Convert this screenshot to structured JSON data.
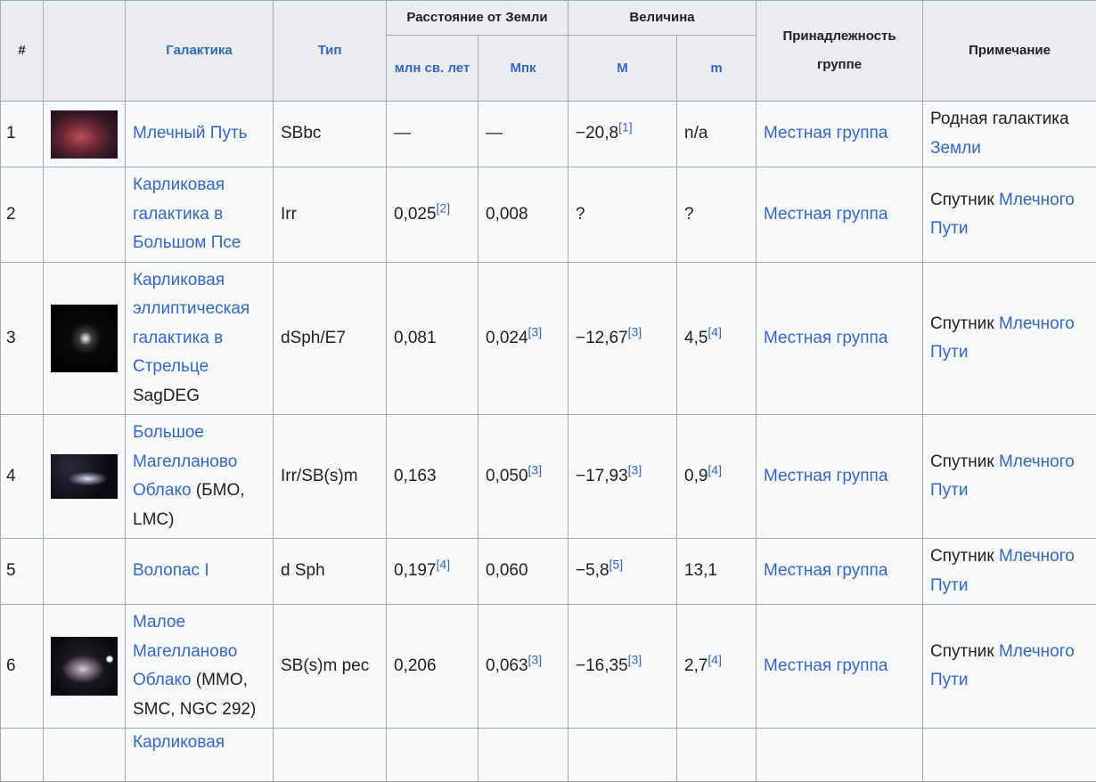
{
  "table": {
    "headers": {
      "num": "#",
      "galaxy": "Галактика",
      "type": "Тип",
      "distance": "Расстояние от Земли",
      "magnitude": "Величина",
      "group": "Принадлежность группе",
      "note": "Примечание",
      "mly": "млн св. лет",
      "mpc": "Мпк",
      "abs_m": "M",
      "app_m": "m"
    },
    "rows": [
      {
        "num": "1",
        "image": "milky-way-thumbnail",
        "name": "Млечный Путь",
        "name_extra": "",
        "type": "SBbc",
        "mly": "—",
        "mly_ref": "",
        "mpc": "—",
        "mpc_ref": "",
        "abs_m": "−20,8",
        "abs_m_ref": "[1]",
        "app_m": "n/a",
        "app_m_ref": "",
        "group": "Местная группа",
        "note_text": "Родная галактика ",
        "note_link": "Земли"
      },
      {
        "num": "2",
        "image": "",
        "name": "Карликовая галактика в Большом Псе",
        "name_extra": "",
        "type": "Irr",
        "mly": "0,025",
        "mly_ref": "[2]",
        "mpc": "0,008",
        "mpc_ref": "",
        "abs_m": "?",
        "abs_m_ref": "",
        "app_m": "?",
        "app_m_ref": "",
        "group": "Местная группа",
        "note_text": "Спутник ",
        "note_link": "Млечного Пути"
      },
      {
        "num": "3",
        "image": "sagdeg-thumbnail",
        "name": "Карликовая эллиптическая галактика в Стрельце",
        "name_extra": " SagDEG",
        "type": "dSph/E7",
        "mly": "0,081",
        "mly_ref": "",
        "mpc": "0,024",
        "mpc_ref": "[3]",
        "abs_m": "−12,67",
        "abs_m_ref": "[3]",
        "app_m": "4,5",
        "app_m_ref": "[4]",
        "group": "Местная группа",
        "note_text": "Спутник ",
        "note_link": "Млечного Пути"
      },
      {
        "num": "4",
        "image": "lmc-thumbnail",
        "name": "Большое Магелланово Облако",
        "name_extra": " (БМО, LMC)",
        "type": "Irr/SB(s)m",
        "mly": "0,163",
        "mly_ref": "",
        "mpc": "0,050",
        "mpc_ref": "[3]",
        "abs_m": "−17,93",
        "abs_m_ref": "[3]",
        "app_m": "0,9",
        "app_m_ref": "[4]",
        "group": "Местная группа",
        "note_text": "Спутник ",
        "note_link": "Млечного Пути"
      },
      {
        "num": "5",
        "image": "",
        "name": "Волопас I",
        "name_extra": "",
        "type": "d Sph",
        "mly": "0,197",
        "mly_ref": "[4]",
        "mpc": "0,060",
        "mpc_ref": "",
        "abs_m": "−5,8",
        "abs_m_ref": "[5]",
        "app_m": "13,1",
        "app_m_ref": "",
        "group": "Местная группа",
        "note_text": "Спутник ",
        "note_link": "Млечного Пути"
      },
      {
        "num": "6",
        "image": "smc-thumbnail",
        "name": "Малое Магелланово Облако",
        "name_extra": " (ММО, SMC, NGC 292)",
        "type": "SB(s)m pec",
        "mly": "0,206",
        "mly_ref": "",
        "mpc": "0,063",
        "mpc_ref": "[3]",
        "abs_m": "−16,35",
        "abs_m_ref": "[3]",
        "app_m": "2,7",
        "app_m_ref": "[4]",
        "group": "Местная группа",
        "note_text": "Спутник ",
        "note_link": "Млечного Пути"
      },
      {
        "num": "",
        "image": "",
        "name": "Карликовая",
        "name_extra": "",
        "type": "",
        "mly": "",
        "mly_ref": "",
        "mpc": "",
        "mpc_ref": "",
        "abs_m": "",
        "abs_m_ref": "",
        "app_m": "",
        "app_m_ref": "",
        "group": "",
        "note_text": "",
        "note_link": ""
      }
    ]
  }
}
